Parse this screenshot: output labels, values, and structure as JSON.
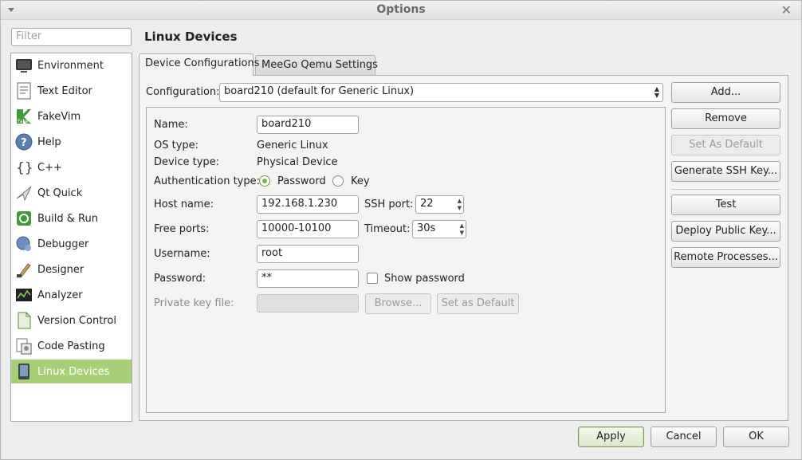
{
  "window": {
    "title": "Options"
  },
  "filter": {
    "placeholder": "Filter"
  },
  "sidebar": {
    "items": [
      {
        "label": "Environment",
        "icon": "monitor-icon"
      },
      {
        "label": "Text Editor",
        "icon": "document-icon"
      },
      {
        "label": "FakeVim",
        "icon": "fakevim-icon"
      },
      {
        "label": "Help",
        "icon": "help-icon"
      },
      {
        "label": "C++",
        "icon": "braces-icon"
      },
      {
        "label": "Qt Quick",
        "icon": "paper-plane-icon"
      },
      {
        "label": "Build & Run",
        "icon": "build-icon"
      },
      {
        "label": "Debugger",
        "icon": "bug-icon"
      },
      {
        "label": "Designer",
        "icon": "brush-icon"
      },
      {
        "label": "Analyzer",
        "icon": "chart-icon"
      },
      {
        "label": "Version Control",
        "icon": "file-tree-icon"
      },
      {
        "label": "Code Pasting",
        "icon": "clipboard-icon"
      },
      {
        "label": "Linux Devices",
        "icon": "device-icon",
        "selected": true
      }
    ]
  },
  "page": {
    "title": "Linux Devices"
  },
  "tabs": [
    {
      "label": "Device Configurations",
      "active": true
    },
    {
      "label": "MeeGo Qemu Settings",
      "active": false
    }
  ],
  "config": {
    "label": "Configuration:",
    "value": "board210 (default for Generic Linux)"
  },
  "form": {
    "name_label": "Name:",
    "name_value": "board210",
    "os_type_label": "OS type:",
    "os_type_value": "Generic Linux",
    "device_type_label": "Device type:",
    "device_type_value": "Physical Device",
    "auth_label": "Authentication type:",
    "auth_password": "Password",
    "auth_key": "Key",
    "auth_selected": "Password",
    "host_label": "Host name:",
    "host_value": "192.168.1.230",
    "ssh_port_label": "SSH port:",
    "ssh_port_value": "22",
    "free_ports_label": "Free ports:",
    "free_ports_value": "10000-10100",
    "timeout_label": "Timeout:",
    "timeout_value": "30s",
    "username_label": "Username:",
    "username_value": "root",
    "password_label": "Password:",
    "password_value": "**",
    "show_password_label": "Show password",
    "private_key_label": "Private key file:",
    "private_key_value": "",
    "browse_label": "Browse...",
    "set_as_default_label": "Set as Default"
  },
  "side_buttons": {
    "add": "Add...",
    "remove": "Remove",
    "set_default": "Set As Default",
    "generate_ssh": "Generate SSH Key...",
    "test": "Test",
    "deploy_key": "Deploy Public Key...",
    "remote_processes": "Remote Processes..."
  },
  "footer": {
    "apply": "Apply",
    "cancel": "Cancel",
    "ok": "OK"
  },
  "colors": {
    "selection": "#a7cf75",
    "window_bg": "#ededed"
  }
}
